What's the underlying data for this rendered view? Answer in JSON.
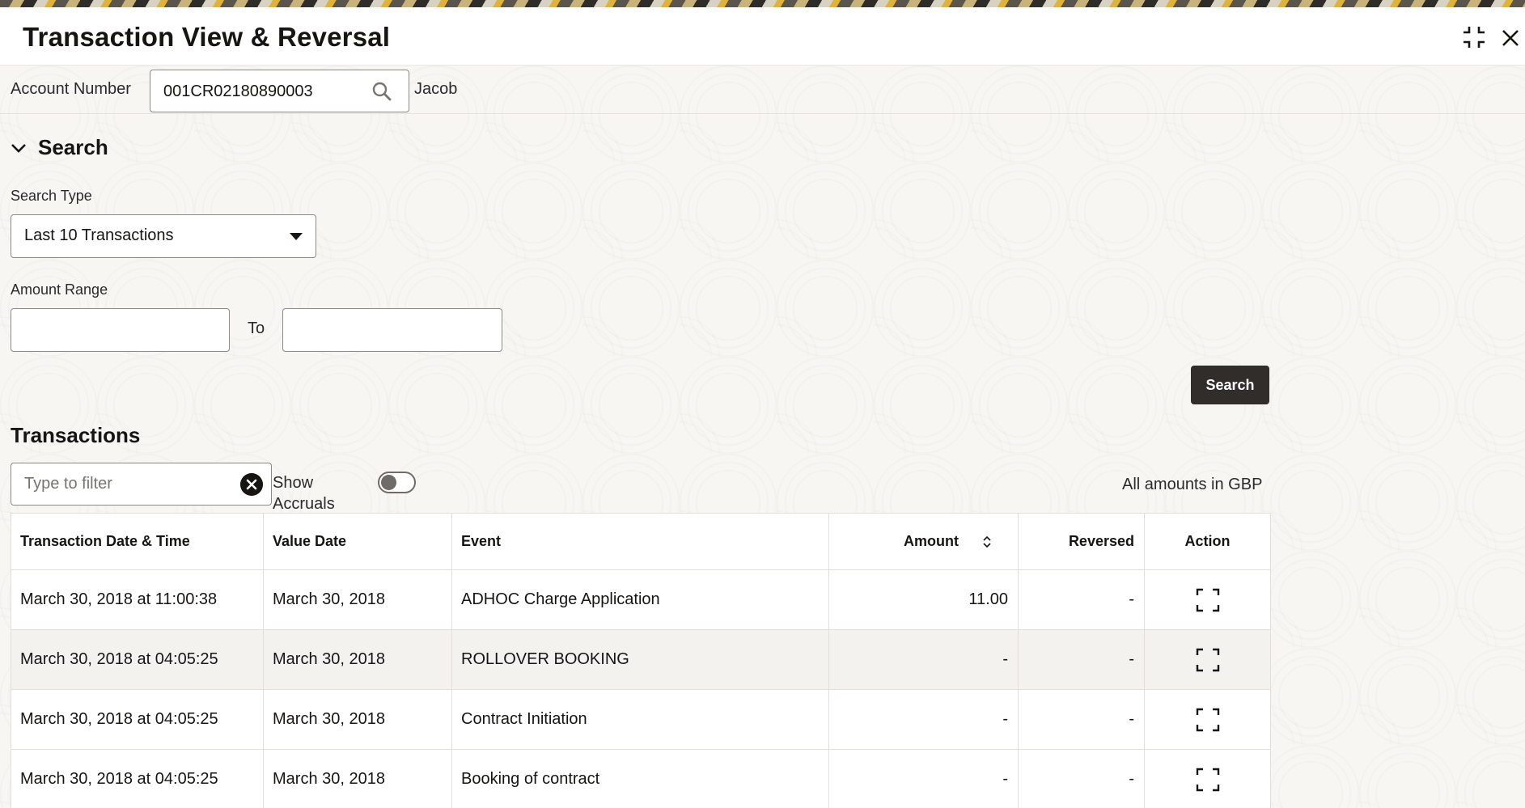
{
  "header": {
    "title": "Transaction View & Reversal"
  },
  "account": {
    "label": "Account Number",
    "value": "001CR02180890003",
    "customer_name": "Jacob"
  },
  "search": {
    "section_title": "Search",
    "search_type_label": "Search Type",
    "search_type_value": "Last 10 Transactions",
    "amount_range_label": "Amount Range",
    "amount_from": "",
    "amount_to": "",
    "to_label": "To",
    "button_label": "Search"
  },
  "transactions": {
    "section_title": "Transactions",
    "filter_placeholder": "Type to filter",
    "show_accruals_label_1": "Show",
    "show_accruals_label_2": "Accruals",
    "show_accruals_on": false,
    "currency_note": "All amounts in GBP",
    "columns": [
      "Transaction Date & Time",
      "Value Date",
      "Event",
      "Amount",
      "Reversed",
      "Action"
    ],
    "rows": [
      {
        "datetime": "March 30, 2018 at 11:00:38",
        "value_date": "March 30, 2018",
        "event": "ADHOC Charge Application",
        "amount": "11.00",
        "reversed": "-"
      },
      {
        "datetime": "March 30, 2018 at 04:05:25",
        "value_date": "March 30, 2018",
        "event": "ROLLOVER BOOKING",
        "amount": "-",
        "reversed": "-"
      },
      {
        "datetime": "March 30, 2018 at 04:05:25",
        "value_date": "March 30, 2018",
        "event": "Contract Initiation",
        "amount": "-",
        "reversed": "-"
      },
      {
        "datetime": "March 30, 2018 at 04:05:25",
        "value_date": "March 30, 2018",
        "event": "Booking of contract",
        "amount": "-",
        "reversed": "-"
      }
    ]
  },
  "icons": {
    "minimize": "collapse-icon",
    "close": "close-icon",
    "search": "search-icon",
    "chevron": "chevron-down-icon",
    "clear": "clear-icon",
    "sort": "sort-icon",
    "expand": "expand-icon"
  },
  "colors": {
    "primary_button": "#312d2a",
    "border": "#8c8a86",
    "page_background": "#f7f6f3"
  }
}
